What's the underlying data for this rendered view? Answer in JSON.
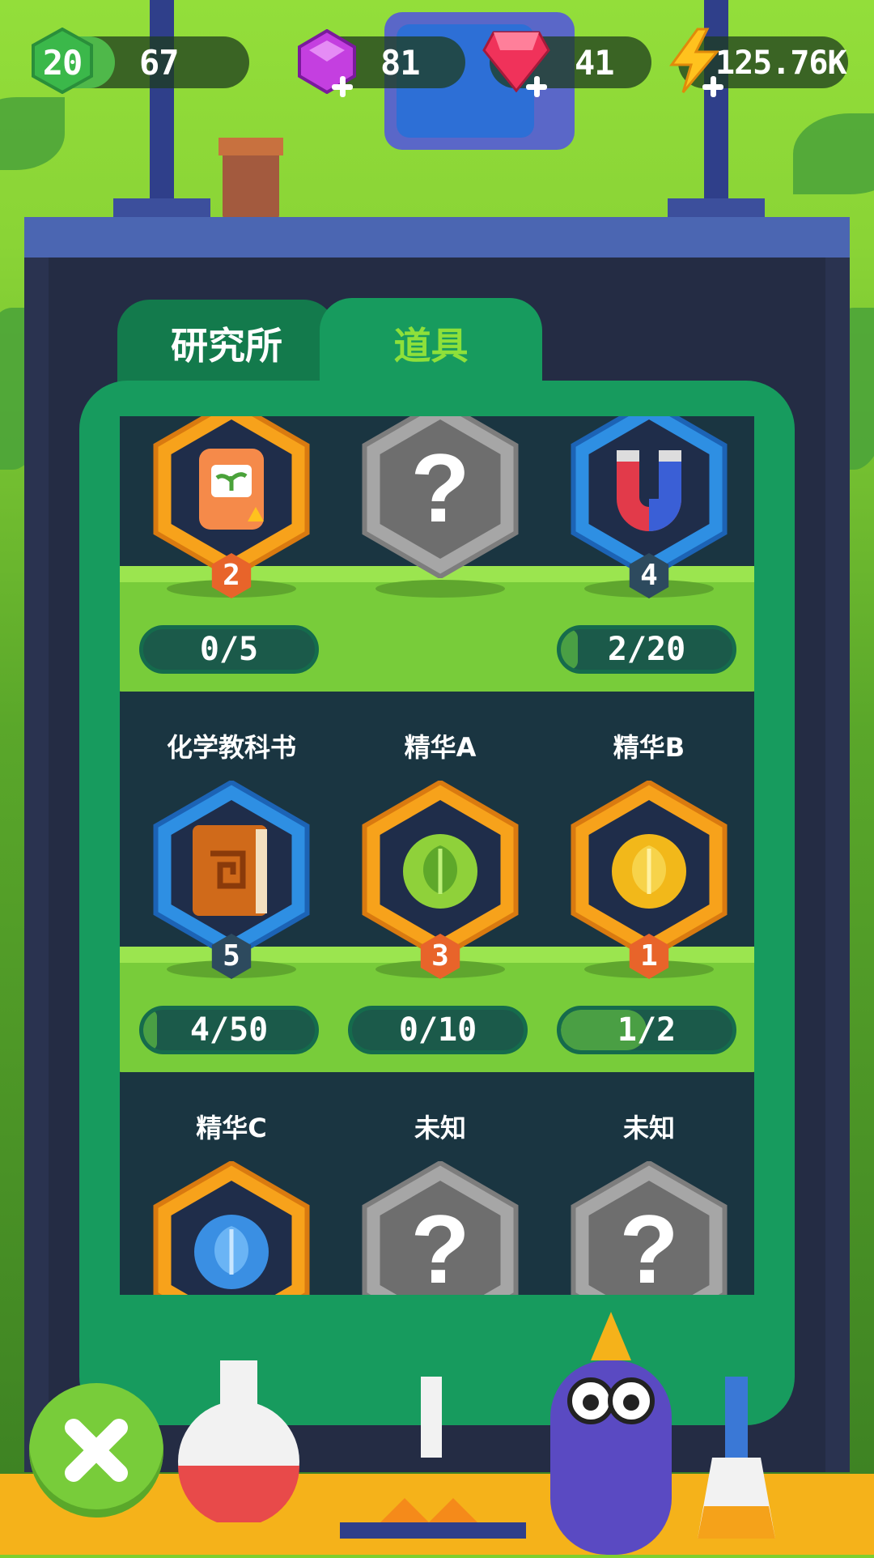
{
  "hud": {
    "level": "20",
    "xp": "67",
    "purple_gems": "81",
    "red_gems": "41",
    "energy": "125.76K",
    "icons": [
      "level-hex-icon",
      "purple-gem-icon",
      "red-gem-icon",
      "lightning-icon"
    ]
  },
  "tabs": [
    {
      "label": "研究所",
      "active": false
    },
    {
      "label": "道具",
      "active": true
    }
  ],
  "rows": [
    {
      "items": [
        {
          "name": "",
          "icon": "seed-bag-icon",
          "frame": "orange",
          "level": "2",
          "progress": "0/5",
          "fill": 0
        },
        {
          "name": "",
          "icon": "question-mark-icon",
          "frame": "gray",
          "level": "",
          "progress": "",
          "fill": 0
        },
        {
          "name": "",
          "icon": "magnet-icon",
          "frame": "blue",
          "level": "4",
          "progress": "2/20",
          "fill": 0.1
        }
      ]
    },
    {
      "items": [
        {
          "name": "化学教科书",
          "icon": "chemistry-book-icon",
          "frame": "blue",
          "level": "5",
          "progress": "4/50",
          "fill": 0.08
        },
        {
          "name": "精华A",
          "icon": "green-essence-icon",
          "frame": "orange",
          "level": "3",
          "progress": "0/10",
          "fill": 0
        },
        {
          "name": "精华B",
          "icon": "yellow-essence-icon",
          "frame": "orange",
          "level": "1",
          "progress": "1/2",
          "fill": 0.5
        }
      ]
    },
    {
      "items": [
        {
          "name": "精华C",
          "icon": "blue-essence-icon",
          "frame": "orange",
          "level": "",
          "progress": "",
          "fill": 0
        },
        {
          "name": "未知",
          "icon": "question-mark-icon",
          "frame": "gray",
          "level": "",
          "progress": "",
          "fill": 0
        },
        {
          "name": "未知",
          "icon": "question-mark-icon",
          "frame": "gray",
          "level": "",
          "progress": "",
          "fill": 0
        }
      ]
    }
  ],
  "colors": {
    "orange_frame": "#f7a21b",
    "blue_frame": "#2e8fe3",
    "gray_frame": "#9a9a9a",
    "panel_green": "#179b5e",
    "active_tab_text": "#8ee03a"
  }
}
